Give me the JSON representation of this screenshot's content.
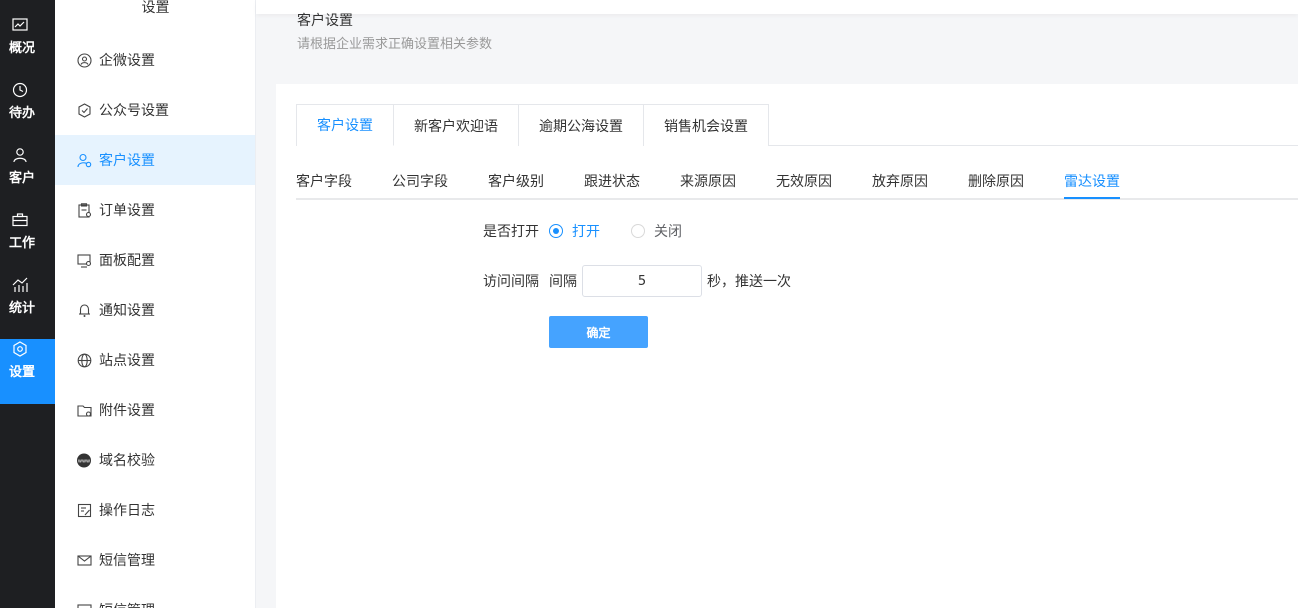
{
  "rail": {
    "items": [
      {
        "label": "概况",
        "icon": "chart-icon"
      },
      {
        "label": "待办",
        "icon": "clock-icon"
      },
      {
        "label": "客户",
        "icon": "user-icon"
      },
      {
        "label": "工作",
        "icon": "briefcase-icon"
      },
      {
        "label": "统计",
        "icon": "stats-icon"
      },
      {
        "label": "设置",
        "icon": "settings-icon",
        "active": true
      }
    ],
    "accent": "#1890ff"
  },
  "menu": {
    "title": "设置",
    "items": [
      {
        "label": "企微设置"
      },
      {
        "label": "公众号设置"
      },
      {
        "label": "客户设置",
        "active": true
      },
      {
        "label": "订单设置"
      },
      {
        "label": "面板配置"
      },
      {
        "label": "通知设置"
      },
      {
        "label": "站点设置"
      },
      {
        "label": "附件设置"
      },
      {
        "label": "域名校验"
      },
      {
        "label": "操作日志"
      },
      {
        "label": "短信管理"
      },
      {
        "label": "短信管理"
      }
    ]
  },
  "header": {
    "title": "客户设置",
    "subtitle": "请根据企业需求正确设置相关参数"
  },
  "card_tabs": [
    "客户设置",
    "新客户欢迎语",
    "逾期公海设置",
    "销售机会设置"
  ],
  "sub_tabs": [
    "客户字段",
    "公司字段",
    "客户级别",
    "跟进状态",
    "来源原因",
    "无效原因",
    "放弃原因",
    "删除原因",
    "雷达设置"
  ],
  "form": {
    "open_label": "是否打开",
    "open_on": "打开",
    "open_off": "关闭",
    "interval_label": "访问间隔",
    "interval_prefix": "间隔",
    "interval_value": "5",
    "interval_suffix": "秒，推送一次",
    "confirm": "确定"
  }
}
